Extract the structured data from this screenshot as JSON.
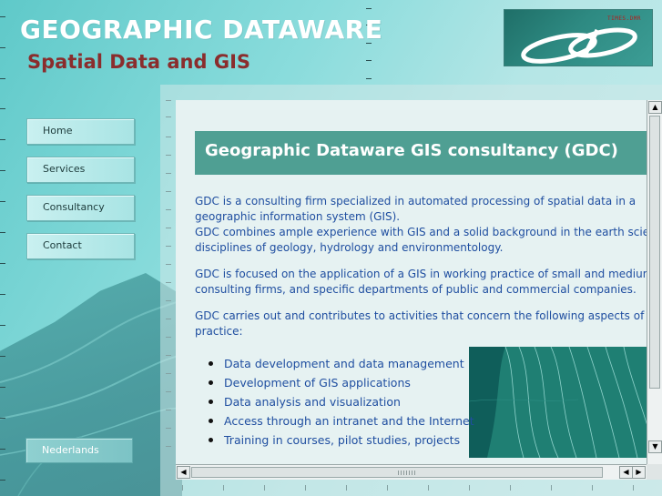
{
  "header": {
    "title": "GEOGRAPHIC DATAWARE",
    "subtitle": "Spatial Data and GIS",
    "logo_stamp": "TIMES.DMR"
  },
  "nav": {
    "items": [
      {
        "label": "Home"
      },
      {
        "label": "Services"
      },
      {
        "label": "Consultancy"
      },
      {
        "label": "Contact"
      }
    ],
    "language_label": "Nederlands"
  },
  "main": {
    "heading": "Geographic Dataware GIS consultancy  (GDC)",
    "paragraphs": [
      "GDC is a consulting firm specialized in automated processing of spatial data in a",
      "geographic information system (GIS).",
      "GDC combines ample experience with GIS and a solid background in the earth scientific",
      "disciplines of geology, hydrology and environmentology.",
      "GDC is focused on the application of a GIS in working practice of small and medium-size",
      "consulting firms, and specific departments of public and commercial companies.",
      "GDC carries out and contributes to activities that concern the following aspects of a GIS",
      "practice:"
    ],
    "bullets": [
      "Data development and data management",
      "Development of GIS applications",
      "Data analysis and visualization",
      "Access through an intranet and the Internet",
      "Training in courses, pilot studies, projects"
    ]
  },
  "scrollbars": {
    "up_icon": "▲",
    "down_icon": "▼",
    "left_icon": "◀",
    "right_icon": "▶"
  },
  "colors": {
    "title": "#ffffff",
    "subtitle": "#8a2d2d",
    "heading_bar": "#4f9f93",
    "body_text": "#1f4ea0"
  }
}
